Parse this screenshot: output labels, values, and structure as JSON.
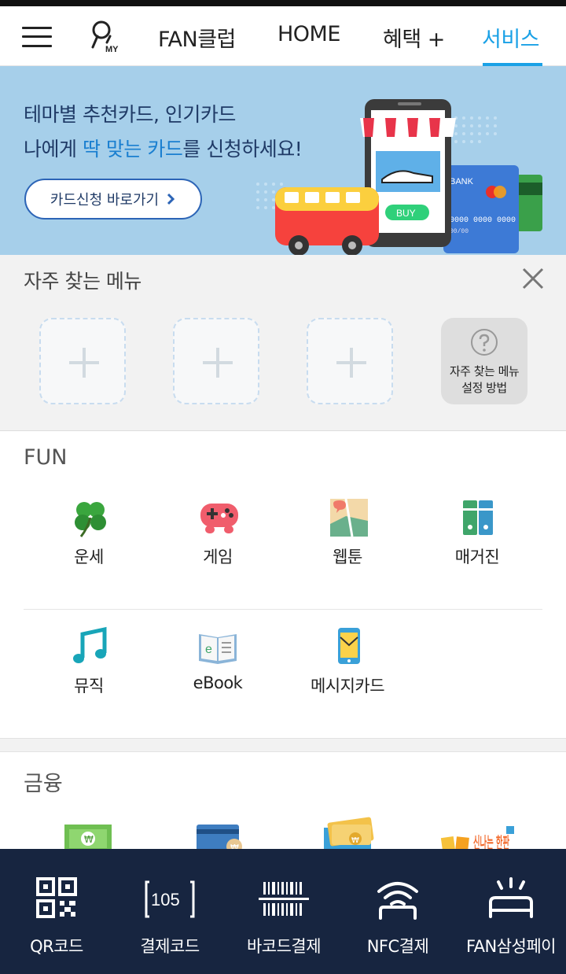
{
  "header": {
    "my_label": "MY",
    "tabs": [
      {
        "label": "FAN클럽"
      },
      {
        "label": "HOME"
      },
      {
        "label": "혜택 +"
      },
      {
        "label": "서비스"
      }
    ],
    "active_color": "#1aa1e6"
  },
  "banner": {
    "line1": "테마별 추천카드, 인기카드",
    "line2_pre": "나에게 ",
    "line2_hl": "딱 맞는 카드",
    "line2_post": "를 신청하세요!",
    "button_label": "카드신청 바로가기",
    "art_buy_label": "BUY",
    "art_bank_label": "BANK",
    "art_card_number": "0000 0000 0000",
    "art_card_expiry": "00/00",
    "background": "#a6cfea"
  },
  "favorites": {
    "title": "자주 찾는 메뉴",
    "help_line1": "자주 찾는 메뉴",
    "help_line2": "설정 방법"
  },
  "fun": {
    "title": "FUN",
    "items": [
      {
        "label": "운세",
        "icon": "clover-icon"
      },
      {
        "label": "게임",
        "icon": "gamepad-icon"
      },
      {
        "label": "웹툰",
        "icon": "webtoon-icon"
      },
      {
        "label": "매거진",
        "icon": "magazine-icon"
      },
      {
        "label": "뮤직",
        "icon": "music-note-icon"
      },
      {
        "label": "eBook",
        "icon": "ebook-icon"
      },
      {
        "label": "메시지카드",
        "icon": "message-card-icon"
      }
    ]
  },
  "finance": {
    "title": "금융",
    "items": [
      {
        "icon": "cash-icon"
      },
      {
        "icon": "card-won-icon"
      },
      {
        "icon": "money-stack-icon"
      },
      {
        "icon": "hanpa-logo-icon"
      }
    ],
    "partial_logo_text": "신나는 한판"
  },
  "bottom_bar": {
    "items": [
      {
        "label": "QR코드",
        "icon": "qr-code-icon"
      },
      {
        "label": "결제코드",
        "icon": "payment-code-icon",
        "icon_text": "105"
      },
      {
        "label": "바코드결제",
        "icon": "barcode-icon"
      },
      {
        "label": "NFC결제",
        "icon": "nfc-icon"
      },
      {
        "label": "FAN삼성페이",
        "icon": "samsung-pay-icon"
      }
    ],
    "background": "#172540"
  }
}
